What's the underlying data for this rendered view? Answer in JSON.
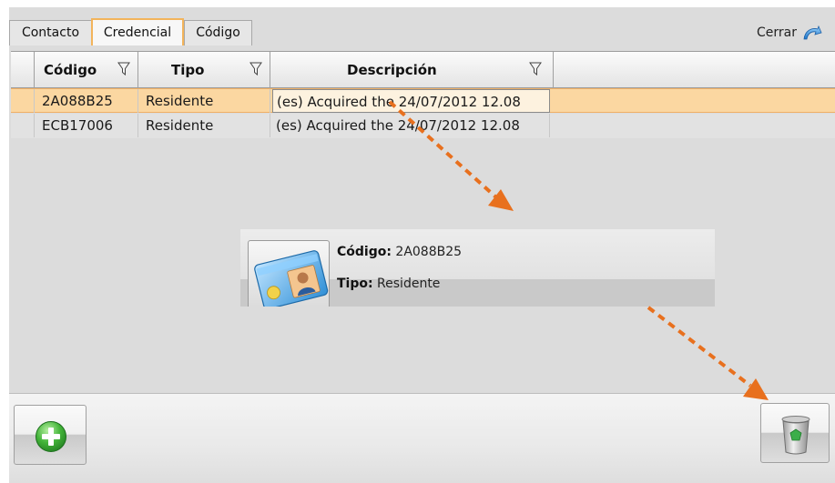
{
  "tabs": [
    {
      "label": "Contacto"
    },
    {
      "label": "Credencial"
    },
    {
      "label": "Código"
    }
  ],
  "close": {
    "label": "Cerrar",
    "icon": "close-arrow-icon"
  },
  "grid": {
    "columns": [
      "Código",
      "Tipo",
      "Descripción"
    ],
    "rows": [
      {
        "codigo": "2A088B25",
        "tipo": "Residente",
        "descripcion": "(es) Acquired the 24/07/2012 12.08"
      },
      {
        "codigo": "ECB17006",
        "tipo": "Residente",
        "descripcion": "(es) Acquired the 24/07/2012 12.08"
      }
    ],
    "selected_row": 0
  },
  "card": {
    "codigo_label": "Código:",
    "codigo_value": "2A088B25",
    "tipo_label": "Tipo:",
    "tipo_value": "Residente"
  },
  "toolbar": {
    "add_icon": "plus-icon",
    "delete_icon": "trash-icon"
  },
  "colors": {
    "selection": "#fbd7a1",
    "active_tab_border": "#f3b45b",
    "arrow": "#e8701e",
    "add_green": "#3aa83a"
  }
}
